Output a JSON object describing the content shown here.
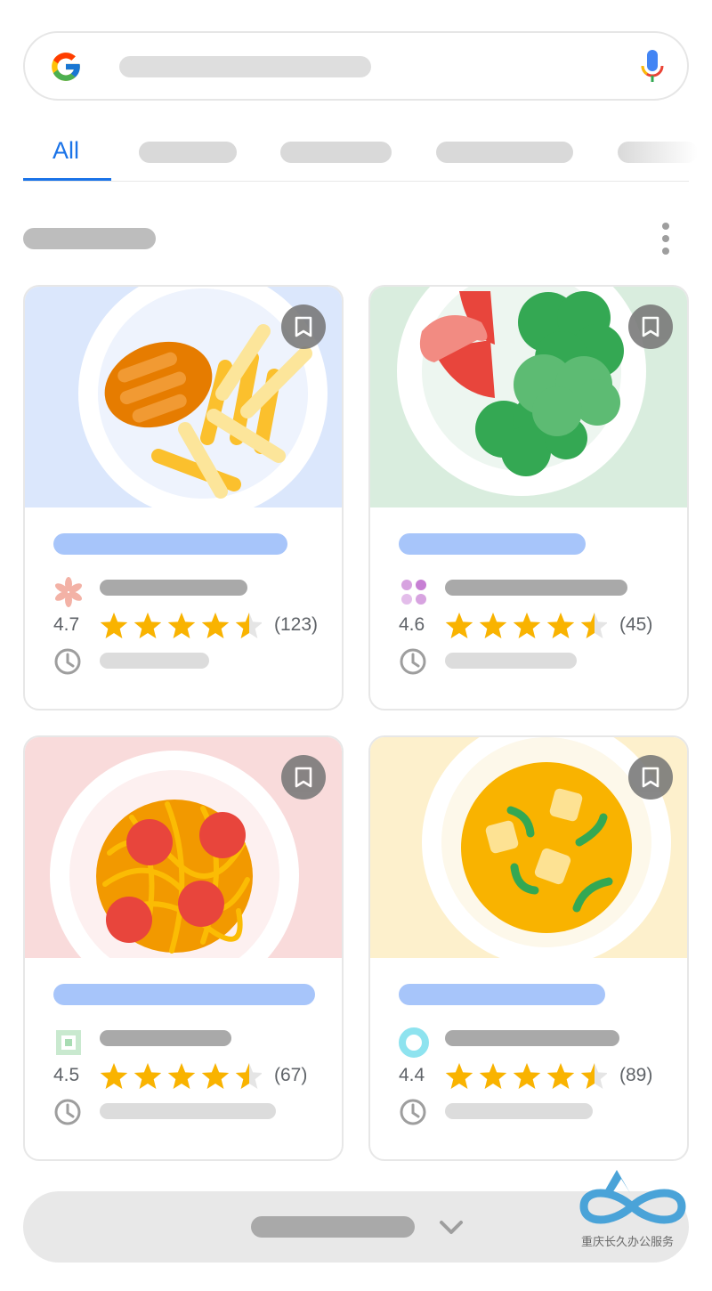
{
  "search": {
    "placeholder": ""
  },
  "tabs": {
    "active_label": "All"
  },
  "cards": [
    {
      "rating": "4.7",
      "stars": 4.5,
      "review_count": "(123)",
      "image": "chicken-and-fries",
      "background": "#dbe7fc"
    },
    {
      "rating": "4.6",
      "stars": 4.5,
      "review_count": "(45)",
      "image": "salad-with-tomato",
      "background": "#d9edde"
    },
    {
      "rating": "4.5",
      "stars": 4.5,
      "review_count": "(67)",
      "image": "spaghetti-meatballs",
      "background": "#f9dbdb"
    },
    {
      "rating": "4.4",
      "stars": 4.5,
      "review_count": "(89)",
      "image": "curry-soup",
      "background": "#fdf0cc"
    }
  ],
  "colors": {
    "accent": "#1a73e8",
    "star": "#f9b300",
    "title_placeholder": "#a7c5fa"
  },
  "watermark": {
    "text": "重庆长久办公服务"
  }
}
